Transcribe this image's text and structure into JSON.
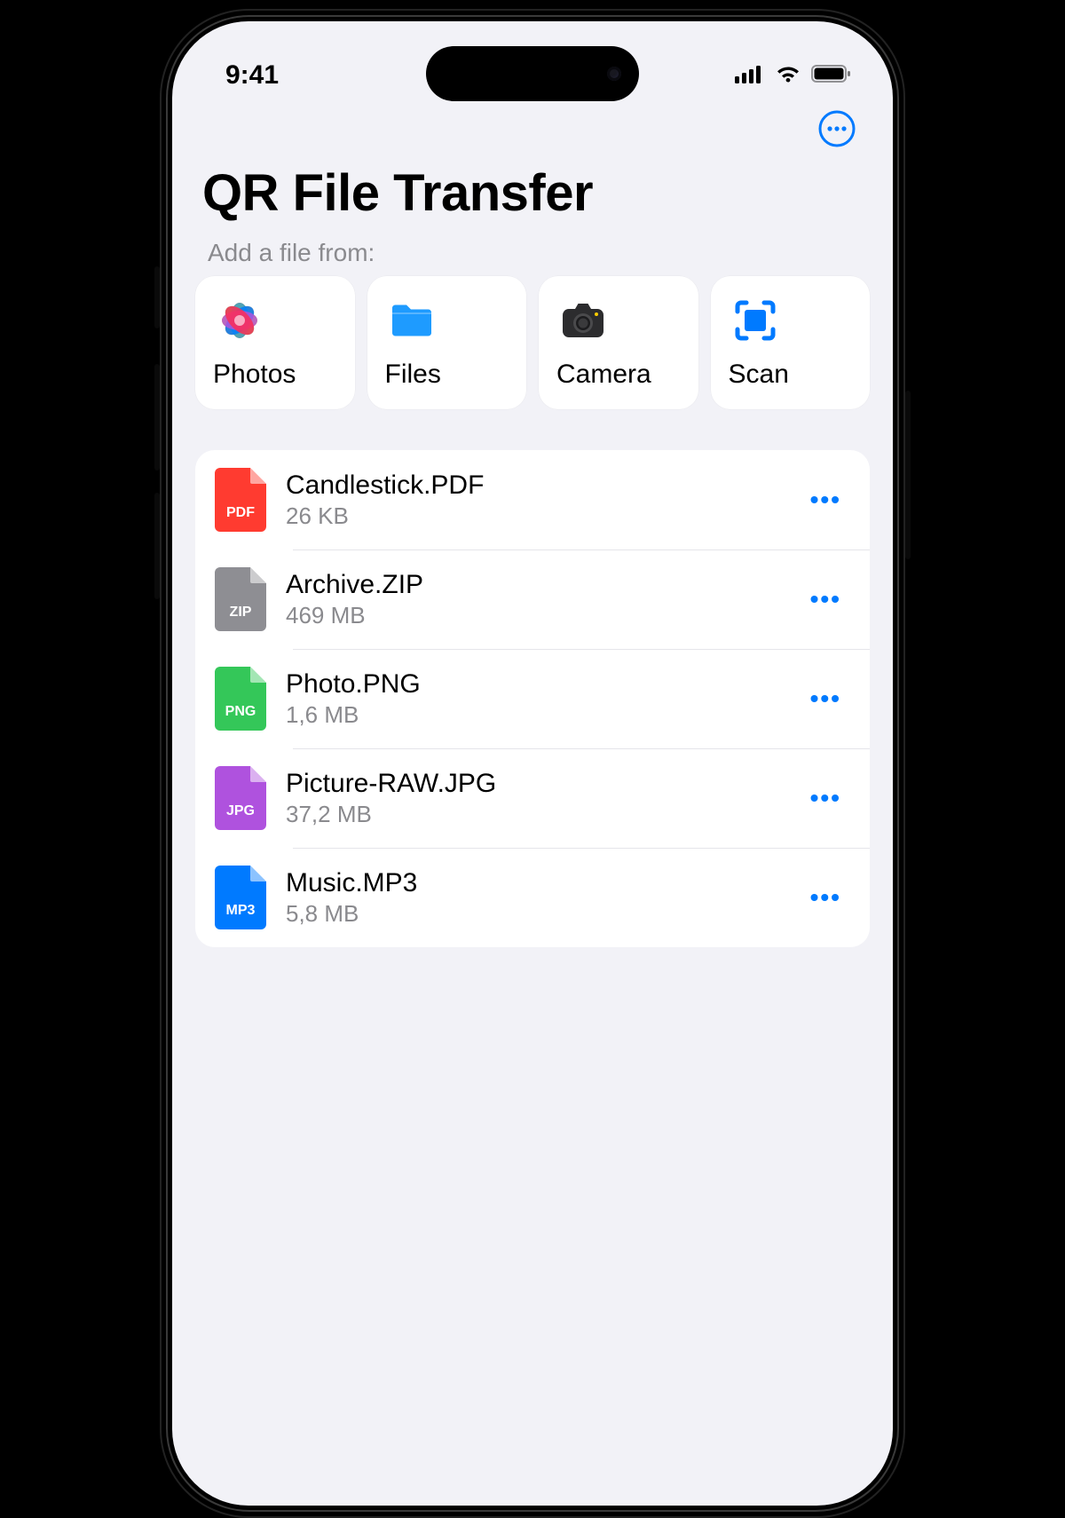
{
  "status": {
    "time": "9:41"
  },
  "header": {
    "title": "QR File Transfer"
  },
  "add_section": {
    "label": "Add a file from:",
    "sources": [
      {
        "id": "photos",
        "label": "Photos"
      },
      {
        "id": "files",
        "label": "Files"
      },
      {
        "id": "camera",
        "label": "Camera"
      },
      {
        "id": "scan",
        "label": "Scan"
      }
    ]
  },
  "files": [
    {
      "name": "Candlestick.PDF",
      "size": "26 KB",
      "ext": "PDF",
      "color": "#FF3B30"
    },
    {
      "name": "Archive.ZIP",
      "size": "469 MB",
      "ext": "ZIP",
      "color": "#8E8E93"
    },
    {
      "name": "Photo.PNG",
      "size": "1,6 MB",
      "ext": "PNG",
      "color": "#34C759"
    },
    {
      "name": "Picture-RAW.JPG",
      "size": "37,2 MB",
      "ext": "JPG",
      "color": "#AF52DE"
    },
    {
      "name": "Music.MP3",
      "size": "5,8 MB",
      "ext": "MP3",
      "color": "#007AFF"
    }
  ],
  "colors": {
    "accent": "#007AFF"
  }
}
